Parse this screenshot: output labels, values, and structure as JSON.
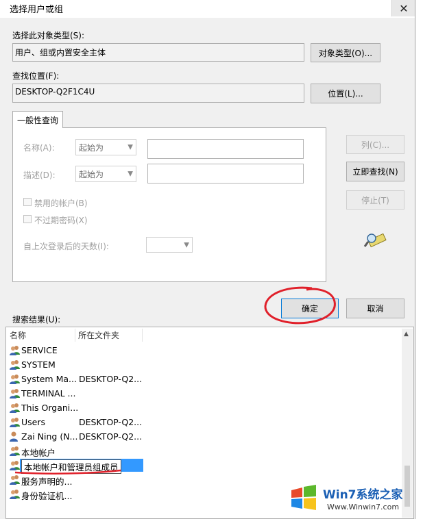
{
  "window": {
    "title": "选择用户或组",
    "close_glyph": "✕"
  },
  "object_type": {
    "label": "选择此对象类型(S):",
    "value": "用户、组或内置安全主体",
    "button": "对象类型(O)..."
  },
  "location": {
    "label": "查找位置(F):",
    "value": "DESKTOP-Q2F1C4U",
    "button": "位置(L)..."
  },
  "query": {
    "tab": "一般性查询",
    "name_label": "名称(A):",
    "name_mode": "起始为",
    "desc_label": "描述(D):",
    "desc_mode": "起始为",
    "disabled_accounts": "禁用的帐户(B)",
    "non_expiring": "不过期密码(X)",
    "days_label": "自上次登录后的天数(I):"
  },
  "buttons": {
    "columns": "列(C)...",
    "find_now": "立即查找(N)",
    "stop": "停止(T)",
    "ok": "确定",
    "cancel": "取消"
  },
  "results": {
    "label": "搜索结果(U):",
    "headers": [
      "名称",
      "所在文件夹"
    ],
    "rows": [
      {
        "name": "SERVICE",
        "folder": "",
        "icon": "group-icon"
      },
      {
        "name": "SYSTEM",
        "folder": "",
        "icon": "group-icon"
      },
      {
        "name": "System Ma...",
        "folder": "DESKTOP-Q2...",
        "icon": "group-icon"
      },
      {
        "name": "TERMINAL ...",
        "folder": "",
        "icon": "group-icon"
      },
      {
        "name": "This Organi...",
        "folder": "",
        "icon": "group-icon"
      },
      {
        "name": "Users",
        "folder": "DESKTOP-Q2...",
        "icon": "group-icon"
      },
      {
        "name": "Zai Ning (N...",
        "folder": "DESKTOP-Q2...",
        "icon": "user-icon"
      },
      {
        "name": "本地帐户",
        "folder": "",
        "icon": "group-icon"
      },
      {
        "name": "本地帐户和管理员组成员",
        "folder": "",
        "icon": "group-icon",
        "selected": true
      },
      {
        "name": "服务声明的...",
        "folder": "",
        "icon": "group-icon"
      },
      {
        "name": "身份验证机...",
        "folder": "",
        "icon": "group-icon"
      }
    ]
  },
  "watermark": {
    "brand": "Win7系统之家",
    "url": "Www.Winwin7.com"
  },
  "colors": {
    "selection": "#3399ff",
    "annotation": "#e0202a"
  }
}
